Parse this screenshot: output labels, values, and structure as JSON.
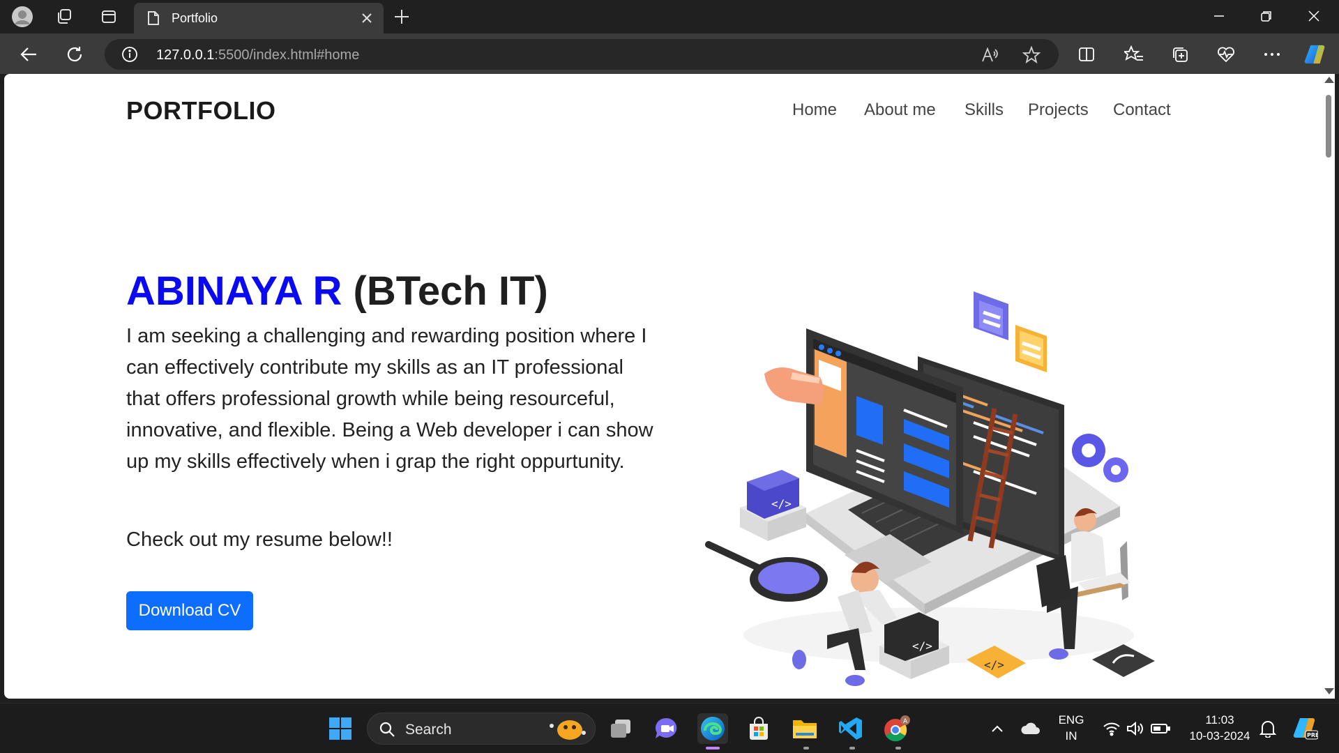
{
  "browser": {
    "tab_title": "Portfolio",
    "url_host": "127.0.0.1",
    "url_rest": ":5500/index.html#home"
  },
  "site": {
    "logo": "PORTFOLIO",
    "nav": [
      "Home",
      "About me",
      "Skills",
      "Projects",
      "Contact"
    ],
    "hero_name": "ABINAYA R",
    "hero_suffix": " (BTech IT)",
    "hero_description": "I am seeking a challenging and rewarding position where I can effectively contribute my skills as an IT professional that offers professional growth while being resourceful, innovative, and flexible. Being a Web developer i can show up my skills effectively when i grap the right oppurtunity.",
    "hero_cta_text": "Check out my resume below!!",
    "download_button": "Download CV",
    "accent_color": "#0a0af0",
    "button_color": "#0d6efd"
  },
  "taskbar": {
    "search_label": "Search",
    "lang_top": "ENG",
    "lang_bottom": "IN",
    "time": "11:03",
    "date": "10-03-2024"
  }
}
